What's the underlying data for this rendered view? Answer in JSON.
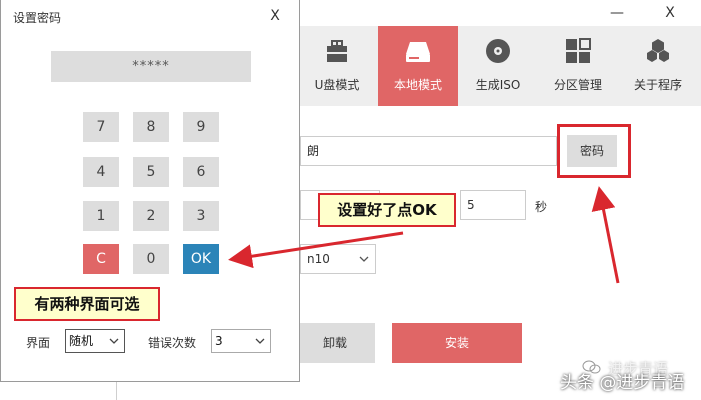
{
  "main_window": {
    "minimize_glyph": "—",
    "close_glyph": "X",
    "nav": [
      {
        "label": "U盘模式",
        "icon": "usb-drive-icon"
      },
      {
        "label": "本地模式",
        "icon": "hard-drive-icon"
      },
      {
        "label": "生成ISO",
        "icon": "disc-icon"
      },
      {
        "label": "分区管理",
        "icon": "grid-icon"
      },
      {
        "label": "关于程序",
        "icon": "hexagons-icon"
      }
    ],
    "active_nav": "本地模式",
    "text_field_partial": "朗",
    "password_button": "密码",
    "seconds_value": "5",
    "seconds_unit": "秒",
    "select_partial": "n10",
    "uninstall_button": "卸载",
    "install_button": "安装"
  },
  "dialog": {
    "title": "设置密码",
    "close_glyph": "X",
    "password_display": "*****",
    "keys": [
      "7",
      "8",
      "9",
      "4",
      "5",
      "6",
      "1",
      "2",
      "3",
      "C",
      "0",
      "OK"
    ],
    "interface_label": "界面",
    "interface_value": "随机",
    "error_count_label": "错误次数",
    "error_count_value": "3"
  },
  "annotations": {
    "ok_callout": "设置好了点OK",
    "interface_callout": "有两种界面可选"
  },
  "watermark": {
    "text": "头条 @进步青语",
    "faint_text": "进步青语"
  },
  "colors": {
    "accent_red": "#e06666",
    "ok_blue": "#2b84b8",
    "annotation_red": "#d9272e",
    "callout_fill": "#ffffcc"
  }
}
